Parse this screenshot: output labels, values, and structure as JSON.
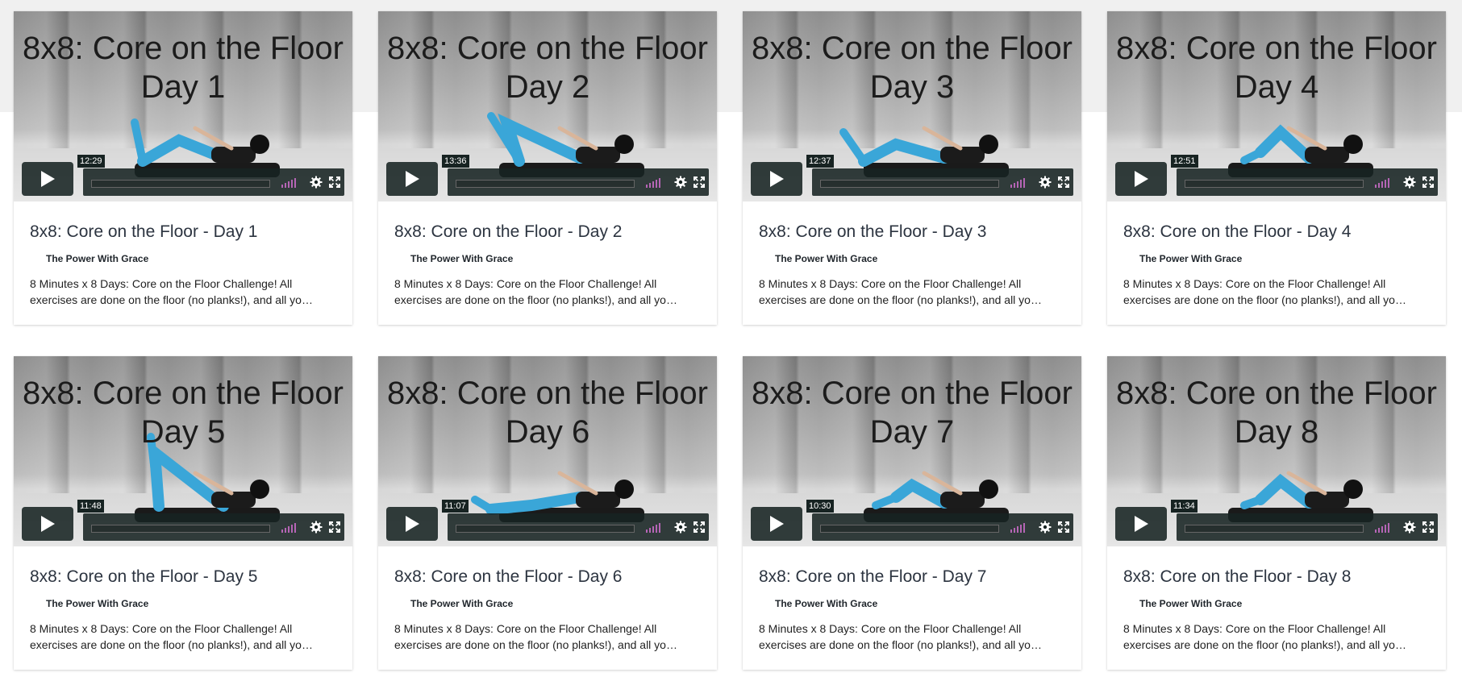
{
  "videos": [
    {
      "thumb_title": "8x8: Core on the Floor\nDay 1",
      "duration": "12:29",
      "title": "8x8: Core on the Floor - Day 1",
      "channel": "The Power With Grace",
      "description": "8 Minutes x 8 Days: Core on the Floor Challenge! All exercises are done on the floor (no planks!), and all yo…"
    },
    {
      "thumb_title": "8x8: Core on the Floor\nDay 2",
      "duration": "13:36",
      "title": "8x8: Core on the Floor - Day 2",
      "channel": "The Power With Grace",
      "description": "8 Minutes x 8 Days: Core on the Floor Challenge! All exercises are done on the floor (no planks!), and all yo…"
    },
    {
      "thumb_title": "8x8: Core on the Floor\nDay 3",
      "duration": "12:37",
      "title": "8x8: Core on the Floor - Day 3",
      "channel": "The Power With Grace",
      "description": "8 Minutes x 8 Days: Core on the Floor Challenge! All exercises are done on the floor (no planks!), and all yo…"
    },
    {
      "thumb_title": "8x8: Core on the Floor\nDay 4",
      "duration": "12:51",
      "title": "8x8: Core on the Floor - Day 4",
      "channel": "The Power With Grace",
      "description": "8 Minutes x 8 Days: Core on the Floor Challenge! All exercises are done on the floor (no planks!), and all yo…"
    },
    {
      "thumb_title": "8x8: Core on the Floor\nDay 5",
      "duration": "11:48",
      "title": "8x8: Core on the Floor - Day 5",
      "channel": "The Power With Grace",
      "description": "8 Minutes x 8 Days: Core on the Floor Challenge! All exercises are done on the floor (no planks!), and all yo…"
    },
    {
      "thumb_title": "8x8: Core on the Floor\nDay 6",
      "duration": "11:07",
      "title": "8x8: Core on the Floor - Day 6",
      "channel": "The Power With Grace",
      "description": "8 Minutes x 8 Days: Core on the Floor Challenge! All exercises are done on the floor (no planks!), and all yo…"
    },
    {
      "thumb_title": "8x8: Core on the Floor\nDay 7",
      "duration": "10:30",
      "title": "8x8: Core on the Floor - Day 7",
      "channel": "The Power With Grace",
      "description": "8 Minutes x 8 Days: Core on the Floor Challenge! All exercises are done on the floor (no planks!), and all yo…"
    },
    {
      "thumb_title": "8x8: Core on the Floor\nDay 8",
      "duration": "11:34",
      "title": "8x8: Core on the Floor - Day 8",
      "channel": "The Power With Grace",
      "description": "8 Minutes x 8 Days: Core on the Floor Challenge! All exercises are done on the floor (no planks!), and all yo…"
    }
  ],
  "icons": {
    "play": "play-icon",
    "volume": "volume-icon",
    "settings": "gear-icon",
    "fullscreen": "fullscreen-icon",
    "channel": "crescent-moon-icon"
  },
  "colors": {
    "accent_volume": "#b565b5",
    "control_bg": "#172322",
    "pants": "#3aa6d8",
    "title_text": "#2c3440"
  }
}
